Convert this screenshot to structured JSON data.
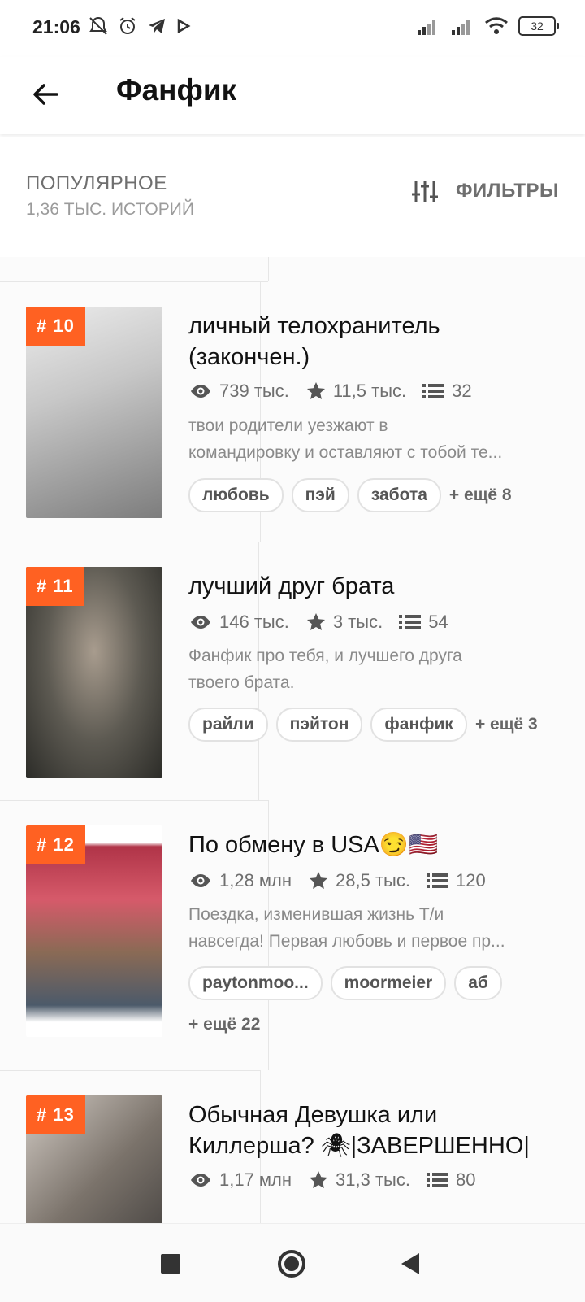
{
  "status_bar": {
    "time": "21:06",
    "battery": "32"
  },
  "app_bar": {
    "title": "Фанфик"
  },
  "filter_bar": {
    "sort_label": "ПОПУЛЯРНОЕ",
    "count": "1,36 ТЫС. ИСТОРИЙ",
    "filters_label": "ФИЛЬТРЫ"
  },
  "stories": [
    {
      "rank": "# 10",
      "title": "личный телохранитель (закончен.)",
      "views": "739 тыс.",
      "votes": "11,5 тыс.",
      "parts": "32",
      "desc_line1": "твои родители уезжают в",
      "desc_line2": "командировку и оставляют с тобой те...",
      "tags": [
        "любовь",
        "пэй",
        "забота"
      ],
      "more": "+ ещё 8",
      "cover_colors": [
        "#d9d9d9",
        "#8a8a8a"
      ]
    },
    {
      "rank": "# 11",
      "title": "лучший друг брата",
      "views": "146 тыс.",
      "votes": "3 тыс.",
      "parts": "54",
      "desc_line1": "Фанфик про тебя, и лучшего друга",
      "desc_line2": "твоего брата.",
      "tags": [
        "райли",
        "пэйтон",
        "фанфик"
      ],
      "more": "+ ещё 3",
      "cover_colors": [
        "#6e6e64",
        "#2a2a26"
      ]
    },
    {
      "rank": "# 12",
      "title": "По обмену в USA😏🇺🇸",
      "views": "1,28 млн",
      "votes": "28,5 тыс.",
      "parts": "120",
      "desc_line1": "Поездка, изменившая жизнь Т/и",
      "desc_line2": "навсегда! Первая любовь и первое пр...",
      "tags": [
        "paytonmoo...",
        "moormeier",
        "аб"
      ],
      "more": "+ ещё 22",
      "cover_colors": [
        "#c23a4d",
        "#3a2d2a"
      ]
    },
    {
      "rank": "# 13",
      "title_line1": "Обычная Девушка или",
      "title_line2": "Киллерша? 🕷|ЗАВЕРШЕННО|",
      "views": "1,17 млн",
      "votes": "31,3 тыс.",
      "parts": "80",
      "cover_colors": [
        "#9a8f86",
        "#3b3a3a"
      ]
    }
  ]
}
